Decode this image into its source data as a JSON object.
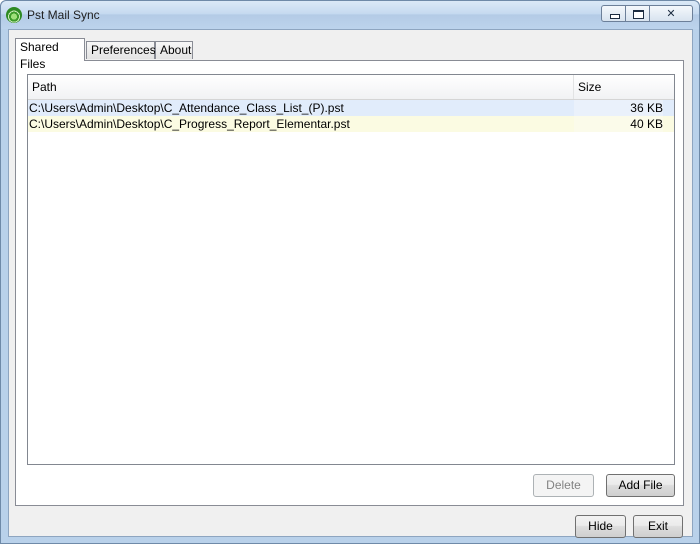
{
  "window": {
    "title": "Pst Mail Sync",
    "app_icon": "wifi-sync-icon",
    "caption_buttons": {
      "minimize": "minimize-icon",
      "maximize": "restore-icon",
      "close": "close-icon"
    }
  },
  "tabs": [
    {
      "label": "Shared Files",
      "active": true
    },
    {
      "label": "Preferences",
      "active": false
    },
    {
      "label": "About",
      "active": false
    }
  ],
  "file_list": {
    "columns": {
      "path": "Path",
      "size": "Size"
    },
    "rows": [
      {
        "path": "C:\\Users\\Admin\\Desktop\\C_Attendance_Class_List_(P).pst",
        "size": "36 KB"
      },
      {
        "path": "C:\\Users\\Admin\\Desktop\\C_Progress_Report_Elementar.pst",
        "size": "40 KB"
      }
    ]
  },
  "panel_buttons": {
    "delete": "Delete",
    "delete_enabled": false,
    "add_file": "Add File"
  },
  "footer_buttons": {
    "hide": "Hide",
    "exit": "Exit"
  },
  "colors": {
    "title_bar": "#c6daf0",
    "row_selected": "#e1ecfb",
    "row_alt": "#fbfbe2"
  }
}
